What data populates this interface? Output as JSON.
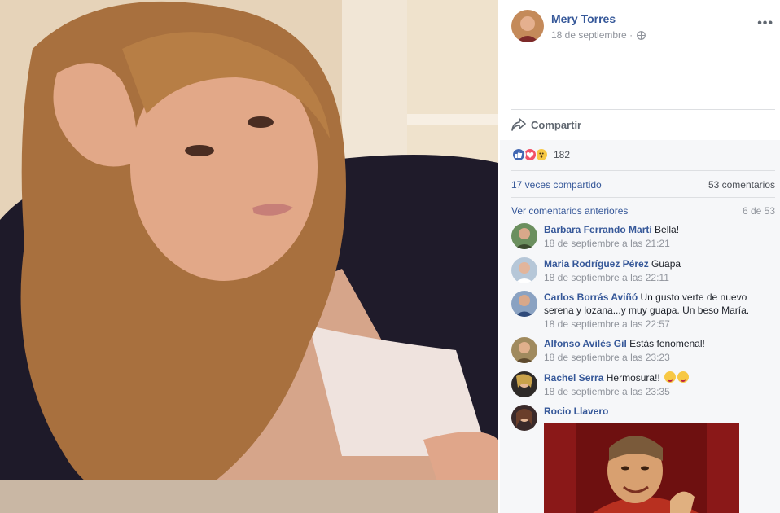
{
  "post": {
    "author": "Mery Torres",
    "date": "18 de septiembre",
    "date_sep": "·",
    "more_label": "•••",
    "share_label": "Compartir",
    "reactions": {
      "icons": [
        "like-icon",
        "love-icon",
        "wow-icon"
      ],
      "count": "182"
    },
    "shares": "17 veces compartido",
    "comments_total": "53 comentarios",
    "view_previous": "Ver comentarios anteriores",
    "page_indicator": "6 de 53"
  },
  "comments": [
    {
      "author": "Barbara Ferrando Martí",
      "text": "Bella!",
      "time": "18 de septiembre a las 21:21"
    },
    {
      "author": "Maria Rodríguez Pérez",
      "text": "Guapa",
      "time": "18 de septiembre a las 22:11"
    },
    {
      "author": "Carlos Borrás Aviñó",
      "text": "Un gusto verte de nuevo serena y lozana...y muy guapa. Un beso María.",
      "time": "18 de septiembre a las 22:57"
    },
    {
      "author": "Alfonso Avilès Gil",
      "text": "Estás fenomenal!",
      "time": "18 de septiembre a las 23:23"
    },
    {
      "author": "Rachel Serra",
      "text": "Hermosura!!",
      "time": "18 de septiembre a las 23:35"
    },
    {
      "author": "Rocio Llavero",
      "text": "",
      "time": ""
    }
  ],
  "colors": {
    "link": "#365899",
    "meta": "#90949c",
    "like": "#4267b2",
    "love": "#f25268",
    "wow": "#f7c844"
  }
}
